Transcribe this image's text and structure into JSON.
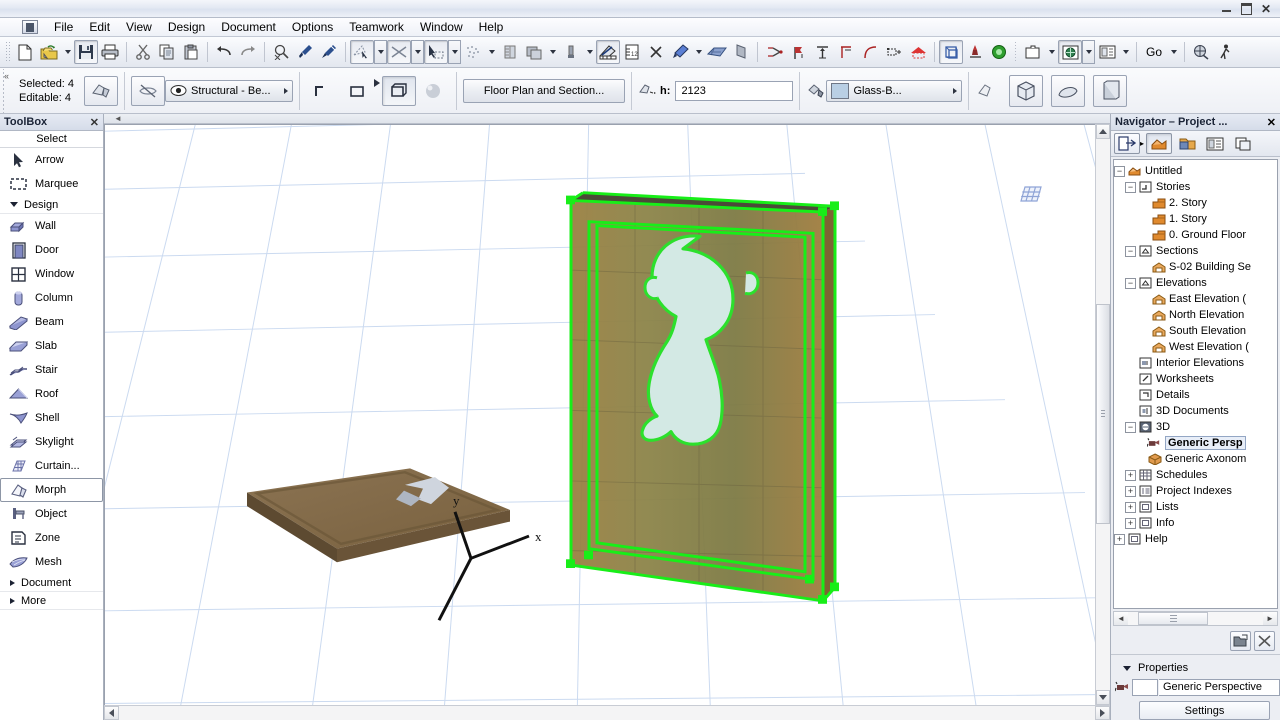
{
  "window": {
    "minimize_label": "–",
    "maximize_label": "□",
    "close_label": "✕"
  },
  "menubar": {
    "app_icon": "archicad-app-icon",
    "items": [
      {
        "label": "File"
      },
      {
        "label": "Edit"
      },
      {
        "label": "View"
      },
      {
        "label": "Design"
      },
      {
        "label": "Document"
      },
      {
        "label": "Options"
      },
      {
        "label": "Teamwork"
      },
      {
        "label": "Window"
      },
      {
        "label": "Help"
      }
    ]
  },
  "toolbar": {
    "groups": [
      {
        "buttons": [
          {
            "name": "new-file",
            "icon": "new-document-icon"
          },
          {
            "name": "open-file",
            "icon": "open-folder-icon",
            "has_arrow": true
          },
          {
            "name": "save-file",
            "icon": "save-disk-icon",
            "pressed": true
          },
          {
            "name": "print",
            "icon": "printer-icon"
          }
        ]
      },
      {
        "buttons": [
          {
            "name": "cut",
            "icon": "scissors-icon"
          },
          {
            "name": "copy",
            "icon": "copy-icon"
          },
          {
            "name": "paste",
            "icon": "paste-icon"
          }
        ]
      },
      {
        "buttons": [
          {
            "name": "undo",
            "icon": "undo-arrow-icon"
          },
          {
            "name": "redo",
            "icon": "redo-arrow-icon"
          }
        ]
      },
      {
        "buttons": [
          {
            "name": "find-select",
            "icon": "magnifier-select-icon"
          },
          {
            "name": "pick-up-parameters",
            "icon": "eyedropper-icon"
          },
          {
            "name": "inject-parameters",
            "icon": "syringe-icon"
          }
        ]
      },
      {
        "buttons": [
          {
            "name": "marquee-tool",
            "icon": "marquee-arrow-icon",
            "boxed": true,
            "has_arrow": true
          },
          {
            "name": "trim-tool",
            "icon": "scissors-trim-icon",
            "boxed": true,
            "has_arrow": true
          },
          {
            "name": "drag-tool",
            "icon": "drag-select-icon",
            "boxed": true,
            "has_arrow": true
          },
          {
            "name": "snap-points",
            "icon": "snap-dots-icon",
            "has_arrow": true
          },
          {
            "name": "grid-snap",
            "icon": "ruler-grid-icon"
          },
          {
            "name": "layers",
            "icon": "layers-stack-icon",
            "has_arrow": true
          },
          {
            "name": "pen-weight",
            "icon": "pen-weight-icon",
            "has_arrow": true
          }
        ]
      },
      {
        "buttons": [
          {
            "name": "measure-tool",
            "icon": "measure-tool-icon",
            "pressed": true
          },
          {
            "name": "dimension",
            "icon": "tape-measure-icon"
          },
          {
            "name": "intersect",
            "icon": "intersect-icon"
          },
          {
            "name": "material-paint",
            "icon": "paint-material-icon",
            "has_arrow": true
          },
          {
            "name": "mesh-surface",
            "icon": "mesh-plane-icon"
          },
          {
            "name": "wall-face",
            "icon": "wall-face-icon"
          }
        ]
      },
      {
        "buttons": [
          {
            "name": "split",
            "icon": "split-scissors-icon"
          },
          {
            "name": "adjust",
            "icon": "adjust-flag-icon"
          },
          {
            "name": "stretch",
            "icon": "stretch-arrow-icon"
          },
          {
            "name": "offset",
            "icon": "offset-corner-icon"
          },
          {
            "name": "fillet",
            "icon": "fillet-curve-icon"
          },
          {
            "name": "multiply",
            "icon": "multiply-icon"
          },
          {
            "name": "solid-operations",
            "icon": "solid-house-icon"
          }
        ]
      },
      {
        "buttons": [
          {
            "name": "3d-cutaway",
            "icon": "cutaway-box-icon",
            "pressed": true
          },
          {
            "name": "marker-tool",
            "icon": "stamp-marker-icon"
          },
          {
            "name": "globe-view",
            "icon": "globe-green-icon"
          }
        ]
      },
      {
        "buttons": [
          {
            "name": "window-layout",
            "icon": "window-layout-icon",
            "has_arrow": true
          },
          {
            "name": "3d-window",
            "icon": "globe-window-icon",
            "pressed": true,
            "has_arrow": true
          },
          {
            "name": "layout-book",
            "icon": "layout-book-icon",
            "has_arrow": true
          }
        ]
      },
      {
        "go_label": "Go",
        "buttons": [
          {
            "name": "publish",
            "icon": "publish-globe-icon"
          },
          {
            "name": "explore-mode",
            "icon": "walk-person-icon"
          }
        ]
      }
    ]
  },
  "infobar": {
    "selected_label": "Selected: 4",
    "editable_label": "Editable: 4",
    "tool_icon": "morph-tool-icon",
    "visibility_icon": "eye-crossed-icon",
    "layer_combo": "Structural - Be...",
    "geometry_buttons": [
      {
        "name": "profile-l-shape",
        "icon": "l-profile-icon"
      },
      {
        "name": "profile-rectangle",
        "icon": "rect-profile-icon"
      },
      {
        "name": "profile-box",
        "icon": "box-profile-icon",
        "selected": true
      },
      {
        "name": "profile-sphere",
        "icon": "sphere-profile-icon"
      }
    ],
    "display_button": "Floor Plan and Section...",
    "height_icon": "morph-height-icon",
    "height_label": "h:",
    "height_value": "2123",
    "material_icon": "paint-bucket-icon",
    "material_swatch_color": "#b9cfe4",
    "material_combo": "Glass-B...",
    "right_icons": [
      {
        "name": "morph-settings",
        "icon": "morph-small-icon"
      },
      {
        "name": "view-3d-box",
        "icon": "cube-3d-icon"
      },
      {
        "name": "view-shell",
        "icon": "shell-view-icon"
      },
      {
        "name": "view-solid",
        "icon": "solid-view-icon"
      }
    ]
  },
  "toolbox": {
    "title": "ToolBox",
    "close_label": "✕",
    "select_group": "Select",
    "items": [
      {
        "label": "Arrow",
        "icon": "arrow-cursor-icon"
      },
      {
        "label": "Marquee",
        "icon": "marquee-dashed-icon"
      }
    ],
    "design_group": {
      "label": "Design",
      "expanded": true
    },
    "design_items": [
      {
        "label": "Wall",
        "icon": "wall-icon"
      },
      {
        "label": "Door",
        "icon": "door-icon"
      },
      {
        "label": "Window",
        "icon": "window-icon"
      },
      {
        "label": "Column",
        "icon": "column-icon"
      },
      {
        "label": "Beam",
        "icon": "beam-icon"
      },
      {
        "label": "Slab",
        "icon": "slab-icon"
      },
      {
        "label": "Stair",
        "icon": "stair-icon"
      },
      {
        "label": "Roof",
        "icon": "roof-icon"
      },
      {
        "label": "Shell",
        "icon": "shell-icon"
      },
      {
        "label": "Skylight",
        "icon": "skylight-icon"
      },
      {
        "label": "Curtain...",
        "icon": "curtain-wall-icon"
      },
      {
        "label": "Morph",
        "icon": "morph-icon",
        "active": true
      },
      {
        "label": "Object",
        "icon": "object-icon"
      },
      {
        "label": "Zone",
        "icon": "zone-icon"
      },
      {
        "label": "Mesh",
        "icon": "mesh-icon"
      }
    ],
    "collapsed_groups": [
      {
        "label": "Document"
      },
      {
        "label": "More"
      }
    ]
  },
  "viewport": {
    "grid_badge_icon": "grid-3x3-icon",
    "axis": {
      "x_label": "x",
      "y_label": "y"
    },
    "scene": {
      "grid_color": "#c8d8ee",
      "background": "#ffffff",
      "wall_panel": {
        "name": "glass-block-wall-morph",
        "fill_color": "#8a8a4e",
        "edge_color": "#9a7b42",
        "selection_color": "#1aee1a",
        "figure_color": "#cfe8e2",
        "figure_name": "cartoon-figure-cutout"
      },
      "slab": {
        "name": "floor-slab-morph",
        "fill_color": "#7d6647",
        "top_color": "#8a7151",
        "inset_color": "#cfd5de"
      }
    }
  },
  "navigator": {
    "title": "Navigator – Project ...",
    "close_label": "✕",
    "toolbar_buttons": [
      {
        "name": "navigator-popup",
        "icon": "navigator-popup-icon",
        "boxed": true,
        "has_arrow": true
      },
      {
        "name": "project-map",
        "icon": "project-map-home-icon",
        "active": true
      },
      {
        "name": "view-map",
        "icon": "view-map-folder-icon"
      },
      {
        "name": "layout-book",
        "icon": "layout-book-nav-icon"
      },
      {
        "name": "publisher-sets",
        "icon": "publisher-sets-icon"
      }
    ],
    "tree": [
      {
        "label": "Untitled",
        "icon": "project-home-icon",
        "depth": 0,
        "expander": "-"
      },
      {
        "label": "Stories",
        "icon": "stories-icon",
        "depth": 1,
        "expander": "-"
      },
      {
        "label": "2. Story",
        "icon": "story-icon",
        "depth": 2
      },
      {
        "label": "1. Story",
        "icon": "story-icon",
        "depth": 2
      },
      {
        "label": "0. Ground Floor",
        "icon": "story-icon",
        "depth": 2
      },
      {
        "label": "Sections",
        "icon": "sections-icon",
        "depth": 1,
        "expander": "-"
      },
      {
        "label": "S-02 Building Se",
        "icon": "section-item-icon",
        "depth": 2
      },
      {
        "label": "Elevations",
        "icon": "elevations-icon",
        "depth": 1,
        "expander": "-"
      },
      {
        "label": "East Elevation (",
        "icon": "elevation-item-icon",
        "depth": 2
      },
      {
        "label": "North Elevation",
        "icon": "elevation-item-icon",
        "depth": 2
      },
      {
        "label": "South Elevation",
        "icon": "elevation-item-icon",
        "depth": 2
      },
      {
        "label": "West Elevation (",
        "icon": "elevation-item-icon",
        "depth": 2
      },
      {
        "label": "Interior Elevations",
        "icon": "interior-elevations-icon",
        "depth": 1
      },
      {
        "label": "Worksheets",
        "icon": "worksheets-icon",
        "depth": 1
      },
      {
        "label": "Details",
        "icon": "details-icon",
        "depth": 1
      },
      {
        "label": "3D Documents",
        "icon": "3d-documents-icon",
        "depth": 1
      },
      {
        "label": "3D",
        "icon": "3d-folder-icon",
        "depth": 1,
        "expander": "-"
      },
      {
        "label": "Generic Persp",
        "icon": "camera-perspective-icon",
        "depth": 2,
        "selected": true
      },
      {
        "label": "Generic Axonom",
        "icon": "axonometric-box-icon",
        "depth": 2
      },
      {
        "label": "Schedules",
        "icon": "schedules-icon",
        "depth": 1,
        "expander": "+"
      },
      {
        "label": "Project Indexes",
        "icon": "project-indexes-icon",
        "depth": 1,
        "expander": "+"
      },
      {
        "label": "Lists",
        "icon": "lists-icon",
        "depth": 1,
        "expander": "+"
      },
      {
        "label": "Info",
        "icon": "info-icon",
        "depth": 1,
        "expander": "+"
      },
      {
        "label": "Help",
        "icon": "help-icon",
        "depth": 0,
        "expander": "+"
      }
    ],
    "action_buttons": [
      {
        "name": "new-view",
        "icon": "new-view-icon"
      },
      {
        "name": "delete-view",
        "icon": "delete-x-icon"
      }
    ],
    "properties": {
      "title": "Properties",
      "camera_icon": "camera-perspective-small-icon",
      "view_name": "Generic Perspective",
      "settings_label": "Settings"
    }
  }
}
